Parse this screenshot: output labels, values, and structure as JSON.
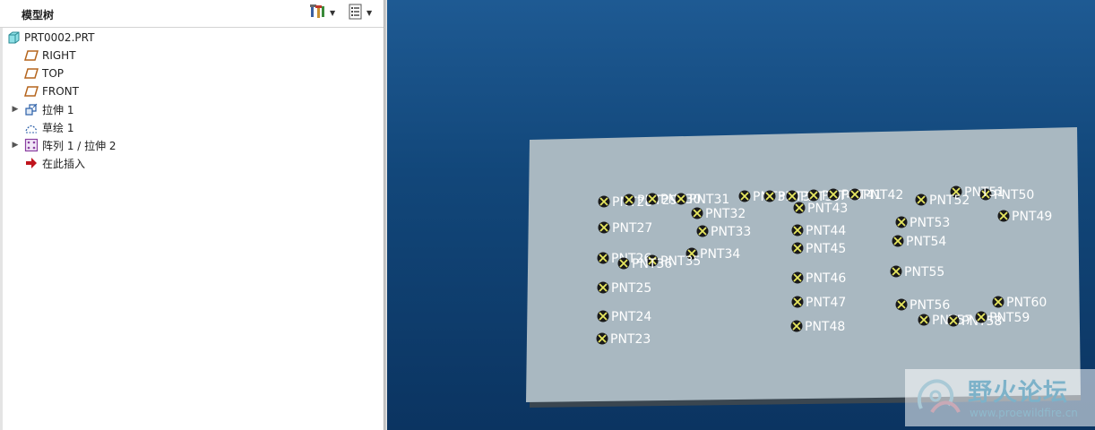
{
  "model_tree": {
    "title": "模型树",
    "header_icons": [
      "settings-tools-icon",
      "display-list-icon"
    ],
    "items": [
      {
        "label": "PRT0002.PRT",
        "icon": "part-icon",
        "expandable": false
      },
      {
        "label": "RIGHT",
        "icon": "datum-plane-icon",
        "expandable": false
      },
      {
        "label": "TOP",
        "icon": "datum-plane-icon",
        "expandable": false
      },
      {
        "label": "FRONT",
        "icon": "datum-plane-icon",
        "expandable": false
      },
      {
        "label": "拉伸 1",
        "icon": "extrude-icon",
        "expandable": true
      },
      {
        "label": "草绘 1",
        "icon": "sketch-icon",
        "expandable": false
      },
      {
        "label": "阵列 1 / 拉伸 2",
        "icon": "pattern-icon",
        "expandable": true
      },
      {
        "label": "在此插入",
        "icon": "insert-here-arrow-icon",
        "expandable": false
      }
    ]
  },
  "viewport": {
    "points": [
      "PNT23",
      "PNT24",
      "PNT25",
      "PNT26",
      "PNT27",
      "PNT28",
      "PNT29",
      "PNT30",
      "PNT31",
      "PNT32",
      "PNT33",
      "PNT34",
      "PNT35",
      "PNT36",
      "PNT37",
      "PNT38",
      "PNT39",
      "PNT40",
      "PNT41",
      "PNT42",
      "PNT43",
      "PNT44",
      "PNT45",
      "PNT46",
      "PNT47",
      "PNT48",
      "PNT49",
      "PNT50",
      "PNT51",
      "PNT52",
      "PNT53",
      "PNT54",
      "PNT55",
      "PNT56",
      "PNT57",
      "PNT58",
      "PNT59",
      "PNT60"
    ]
  },
  "watermark": {
    "title": "野火论坛",
    "url": "www.proewildfire.cn"
  },
  "colors": {
    "viewport_background": "#12477a",
    "plate": "#a9b8c1",
    "point_marker_fill": "#1a1a1a",
    "point_marker_cross": "#e8e860",
    "point_label": "#ffffff"
  }
}
